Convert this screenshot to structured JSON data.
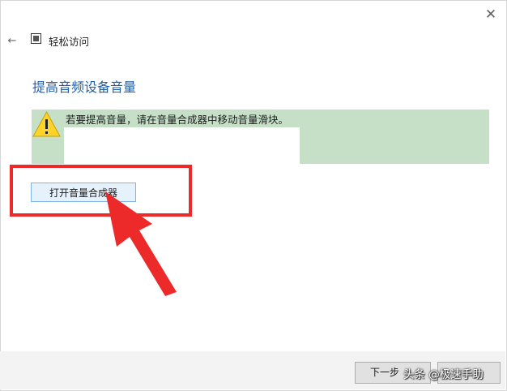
{
  "window": {
    "title": "轻松访问",
    "close_glyph": "✕",
    "back_glyph": "←"
  },
  "page": {
    "title": "提高音频设备音量"
  },
  "warning": {
    "icon": "warning-icon",
    "text": "若要提高音量，请在音量合成器中移动音量滑块。"
  },
  "actions": {
    "open_mixer_label": "打开音量合成器"
  },
  "footer": {
    "next_label": "下一步"
  },
  "watermark": {
    "text": "头条 @极速手助"
  },
  "colors": {
    "accent_title": "#1f5fa8",
    "highlight": "#c6e0c8",
    "annotation_red": "#ec2a2a"
  }
}
